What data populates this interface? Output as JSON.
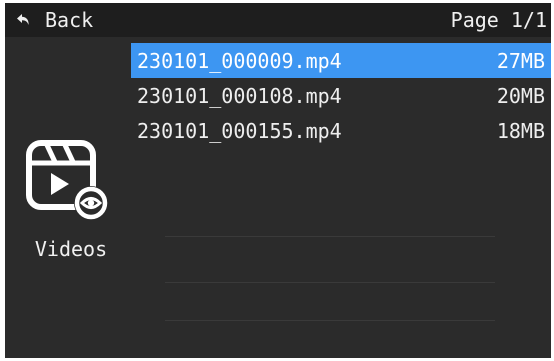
{
  "header": {
    "back_label": "Back",
    "page_label": "Page 1/1"
  },
  "sidebar": {
    "category_label": "Videos",
    "category_icon": "videos-icon"
  },
  "files": [
    {
      "name": "230101_000009.mp4",
      "size": "27MB",
      "selected": true
    },
    {
      "name": "230101_000108.mp4",
      "size": "20MB",
      "selected": false
    },
    {
      "name": "230101_000155.mp4",
      "size": "18MB",
      "selected": false
    }
  ],
  "colors": {
    "background": "#2b2b2b",
    "topbar": "#1e1e1e",
    "selection": "#3d96f2",
    "text": "#f0f0f0"
  }
}
